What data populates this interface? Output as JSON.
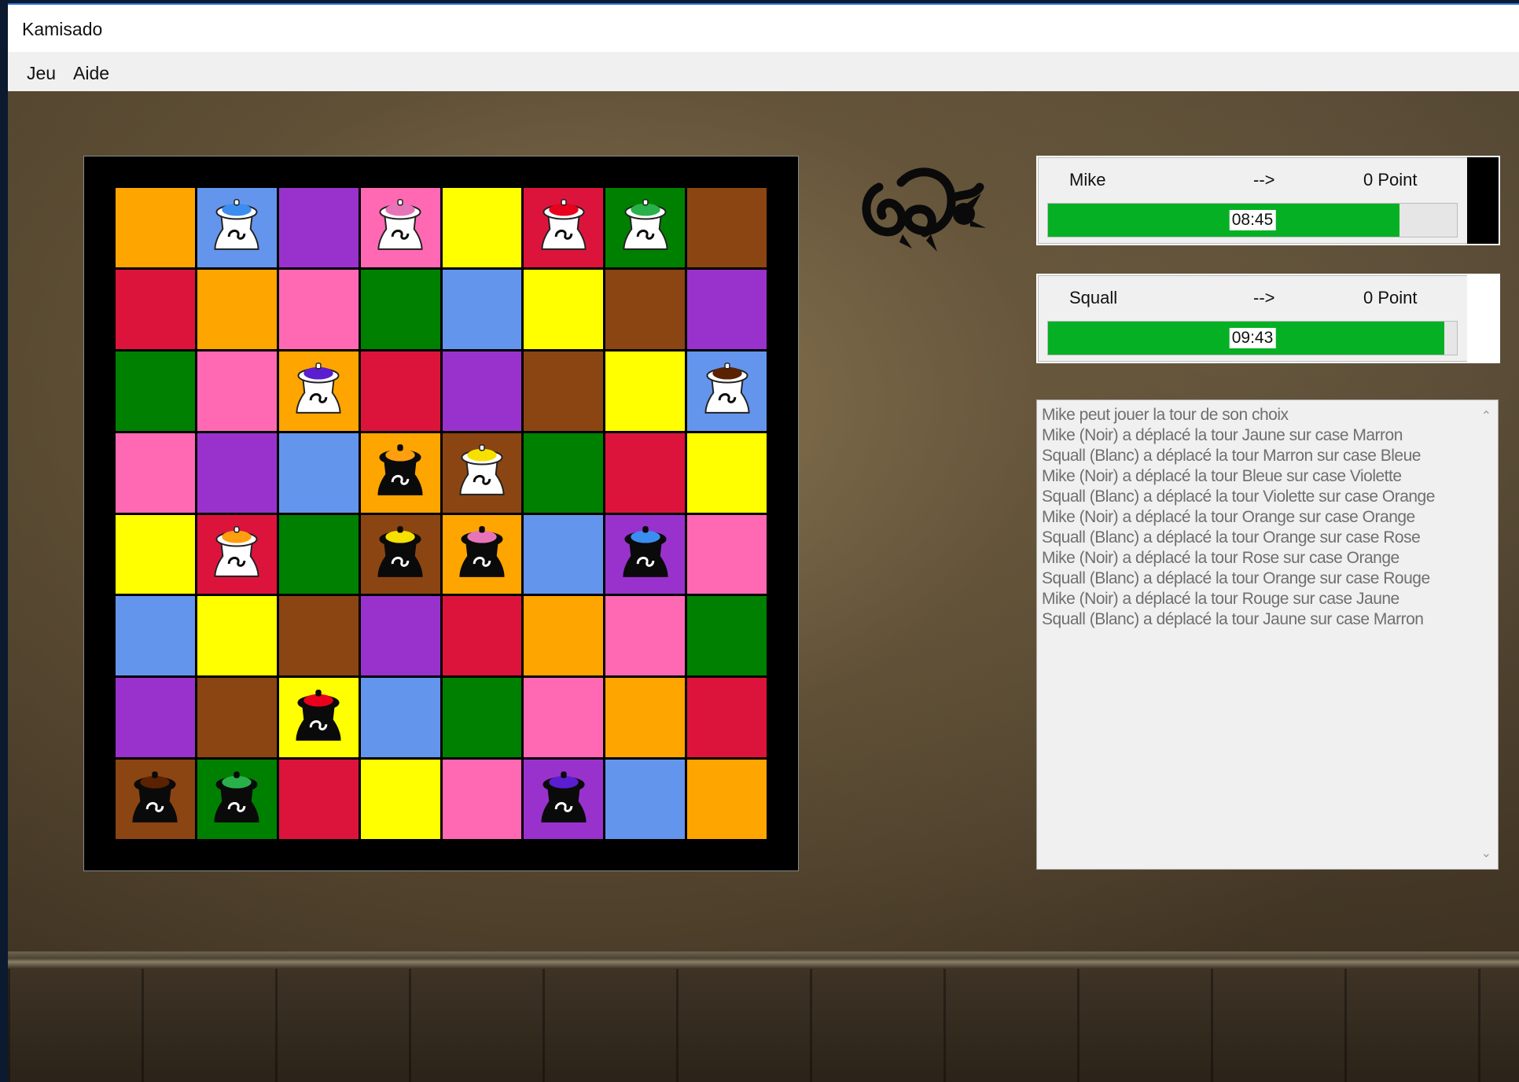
{
  "window": {
    "title": "Kamisado"
  },
  "menu": [
    {
      "label": "Jeu"
    },
    {
      "label": "Aide"
    }
  ],
  "colors": {
    "orange": "#ffa500",
    "bleu": "#6495ed",
    "violet": "#9932cc",
    "rose": "#ff69b4",
    "jaune": "#ffff00",
    "rouge": "#dc143c",
    "vert": "#008000",
    "marron": "#8b4513",
    "cap_bleu": "#3c8df0",
    "cap_rose": "#e874b8",
    "cap_rouge": "#e8001c",
    "cap_vert": "#29b04a",
    "cap_violet": "#5a1dd0",
    "cap_marron": "#5a2200",
    "cap_orange": "#ff9f10",
    "cap_jaune": "#f5e000",
    "progress": "#06b025"
  },
  "board": {
    "rows": [
      [
        "orange",
        "bleu",
        "violet",
        "rose",
        "jaune",
        "rouge",
        "vert",
        "marron"
      ],
      [
        "rouge",
        "orange",
        "rose",
        "vert",
        "bleu",
        "jaune",
        "marron",
        "violet"
      ],
      [
        "vert",
        "rose",
        "orange",
        "rouge",
        "violet",
        "marron",
        "jaune",
        "bleu"
      ],
      [
        "rose",
        "violet",
        "bleu",
        "orange",
        "marron",
        "vert",
        "rouge",
        "jaune"
      ],
      [
        "jaune",
        "rouge",
        "vert",
        "marron",
        "orange",
        "bleu",
        "violet",
        "rose"
      ],
      [
        "bleu",
        "jaune",
        "marron",
        "violet",
        "rouge",
        "orange",
        "rose",
        "vert"
      ],
      [
        "violet",
        "marron",
        "jaune",
        "bleu",
        "vert",
        "rose",
        "orange",
        "rouge"
      ],
      [
        "marron",
        "vert",
        "rouge",
        "jaune",
        "rose",
        "violet",
        "bleu",
        "orange"
      ]
    ],
    "pieces": [
      {
        "row": 0,
        "col": 1,
        "player": "blanc",
        "color": "bleu"
      },
      {
        "row": 0,
        "col": 3,
        "player": "blanc",
        "color": "rose"
      },
      {
        "row": 0,
        "col": 5,
        "player": "blanc",
        "color": "rouge"
      },
      {
        "row": 0,
        "col": 6,
        "player": "blanc",
        "color": "vert"
      },
      {
        "row": 2,
        "col": 2,
        "player": "blanc",
        "color": "violet"
      },
      {
        "row": 2,
        "col": 7,
        "player": "blanc",
        "color": "marron"
      },
      {
        "row": 3,
        "col": 3,
        "player": "noir",
        "color": "orange"
      },
      {
        "row": 3,
        "col": 4,
        "player": "blanc",
        "color": "jaune"
      },
      {
        "row": 4,
        "col": 1,
        "player": "blanc",
        "color": "orange"
      },
      {
        "row": 4,
        "col": 3,
        "player": "noir",
        "color": "jaune"
      },
      {
        "row": 4,
        "col": 4,
        "player": "noir",
        "color": "rose"
      },
      {
        "row": 4,
        "col": 6,
        "player": "noir",
        "color": "bleu"
      },
      {
        "row": 6,
        "col": 2,
        "player": "noir",
        "color": "rouge"
      },
      {
        "row": 7,
        "col": 0,
        "player": "noir",
        "color": "marron"
      },
      {
        "row": 7,
        "col": 1,
        "player": "noir",
        "color": "vert"
      },
      {
        "row": 7,
        "col": 5,
        "player": "noir",
        "color": "violet"
      }
    ]
  },
  "players": [
    {
      "name": "Mike",
      "arrow": "-->",
      "points": "0 Point",
      "time": "08:45",
      "progress": 0.86,
      "indicator": "#000000"
    },
    {
      "name": "Squall",
      "arrow": "-->",
      "points": "0 Point",
      "time": "09:43",
      "progress": 0.97,
      "indicator": "#ffffff"
    }
  ],
  "log": [
    "Mike peut jouer la tour de son choix",
    "Mike (Noir) a déplacé la tour Jaune sur case Marron",
    "Squall (Blanc) a déplacé la tour Marron sur case Bleue",
    "Mike (Noir) a déplacé la tour Bleue sur case Violette",
    "Squall (Blanc) a déplacé la tour Violette sur case Orange",
    "Mike (Noir) a déplacé la tour Orange sur case Orange",
    "Squall (Blanc) a déplacé la tour Orange sur case Rose",
    "Mike (Noir) a déplacé la tour Rose sur case Orange",
    "Squall (Blanc) a déplacé la tour Orange sur case Rouge",
    "Mike (Noir) a déplacé la tour Rouge sur case Jaune",
    "Squall (Blanc) a déplacé la tour Jaune sur case Marron"
  ]
}
